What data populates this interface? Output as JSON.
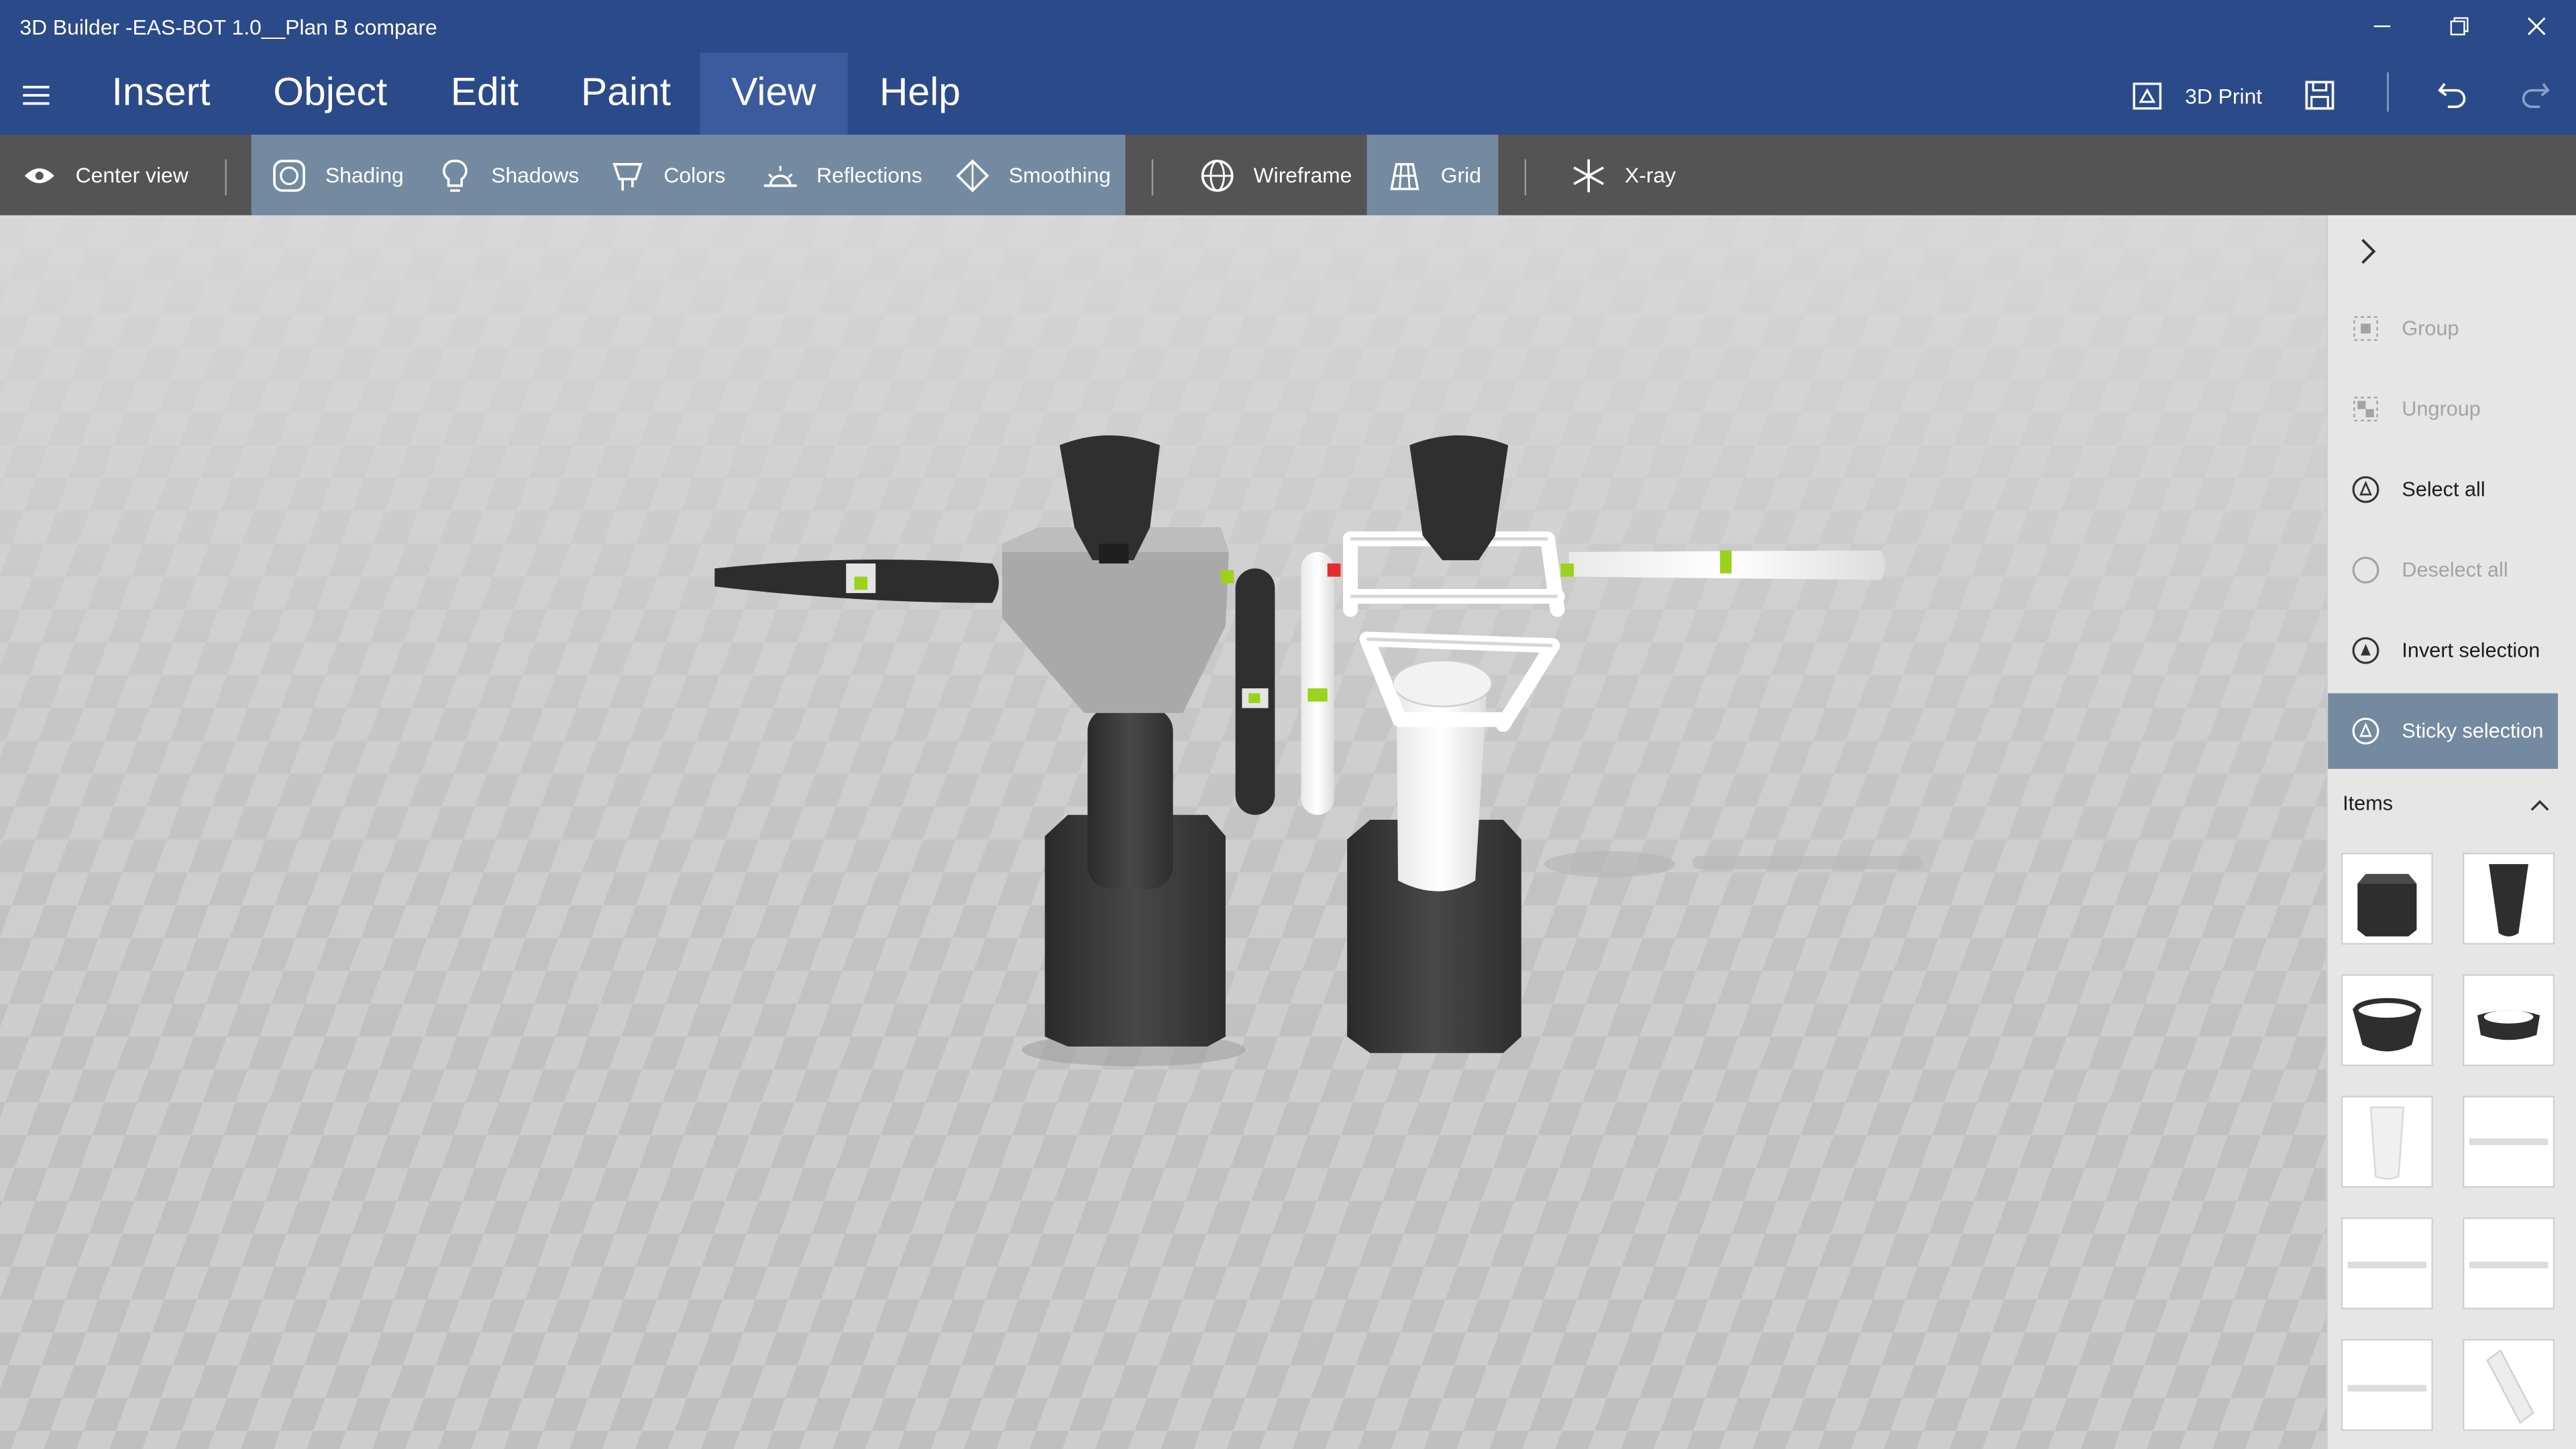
{
  "app": {
    "title": "3D Builder -EAS-BOT 1.0__Plan B compare",
    "window_controls": [
      "minimize-icon",
      "restore-icon",
      "close-icon"
    ]
  },
  "menu": {
    "items": [
      {
        "label": "Insert",
        "active": false
      },
      {
        "label": "Object",
        "active": false
      },
      {
        "label": "Edit",
        "active": false
      },
      {
        "label": "Paint",
        "active": false
      },
      {
        "label": "View",
        "active": true
      },
      {
        "label": "Help",
        "active": false
      }
    ],
    "print_label": "3D Print"
  },
  "ribbon": {
    "center_view": "Center view",
    "shading": "Shading",
    "shadows": "Shadows",
    "colors": "Colors",
    "reflections": "Reflections",
    "smoothing": "Smoothing",
    "wireframe": "Wireframe",
    "grid": "Grid",
    "xray": "X-ray",
    "selected": [
      "Shading",
      "Shadows",
      "Colors",
      "Reflections",
      "Smoothing",
      "Grid"
    ]
  },
  "side_panel": {
    "actions": [
      {
        "label": "Group",
        "enabled": false,
        "selected": false
      },
      {
        "label": "Ungroup",
        "enabled": false,
        "selected": false
      },
      {
        "label": "Select all",
        "enabled": true,
        "selected": false
      },
      {
        "label": "Deselect all",
        "enabled": false,
        "selected": false
      },
      {
        "label": "Invert selection",
        "enabled": true,
        "selected": false
      },
      {
        "label": "Sticky selection",
        "enabled": true,
        "selected": true
      }
    ],
    "items_header": "Items",
    "items": [
      "dark-box",
      "dark-cup",
      "dark-bowl",
      "dark-ring",
      "white-cylinder",
      "bar",
      "bar",
      "bar",
      "bar",
      "angled-tube"
    ]
  },
  "colors": {
    "accent": "#2b4a8a",
    "ribbon": "#545454",
    "selected": "#748aa0",
    "panel": "#e6e6e6"
  }
}
